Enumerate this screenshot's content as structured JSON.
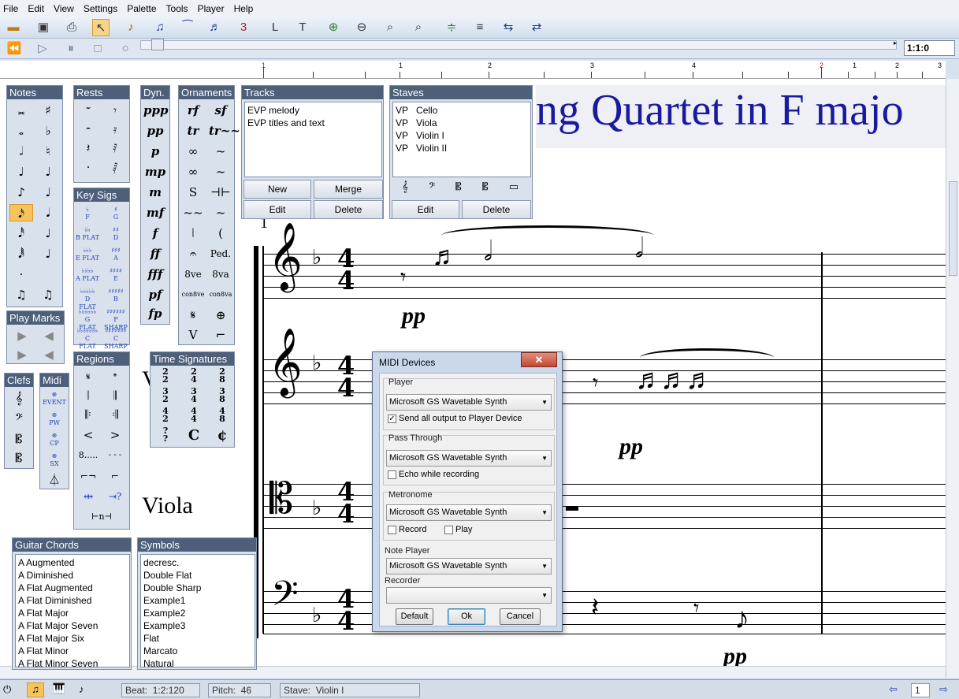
{
  "menu": [
    "File",
    "Edit",
    "View",
    "Settings",
    "Palette",
    "Tools",
    "Player",
    "Help"
  ],
  "toolbar_icons": [
    "open-icon",
    "save-icon",
    "print-icon",
    "select-arrow-icon",
    "eighth-note-icon",
    "beamed-notes-icon",
    "tie-icon",
    "slur-icon",
    "triplet-icon",
    "L-tool-icon",
    "T-tool-icon",
    "zoom-in-icon",
    "zoom-out-icon",
    "zoom-fit-icon",
    "zoom-region-icon",
    "add-staff-icon",
    "remove-staff-icon",
    "move-staff-up-icon",
    "move-staff-down-icon"
  ],
  "transport": {
    "position": "1:1:0"
  },
  "ruler": {
    "marks": [
      "1",
      "1",
      "2",
      "3",
      "4",
      "2",
      "1",
      "2",
      "3"
    ]
  },
  "score": {
    "title": "ng Quartet in F majo",
    "measure_number": "1",
    "names": [
      "Vi",
      "Viola"
    ],
    "dynamics": [
      "pp",
      "pp",
      "pp"
    ],
    "time_sig_top": "4",
    "time_sig_bottom": "4"
  },
  "palettes": {
    "notes": {
      "title": "Notes"
    },
    "rests": {
      "title": "Rests"
    },
    "dyn": {
      "title": "Dyn.",
      "items": [
        "ppp",
        "pp",
        "p",
        "mp",
        "m",
        "mf",
        "f",
        "ff",
        "fff",
        "pf",
        "fp"
      ]
    },
    "ornaments": {
      "title": "Ornaments",
      "items": [
        "rf",
        "sf",
        "tr",
        "tr~~",
        "∞",
        "~",
        "∞",
        "~",
        "S",
        "⊣⊢",
        "~~",
        "~",
        "⦚",
        "(",
        "𝄐",
        "Ped.",
        "8ve",
        "8va",
        "con8ve",
        "con8va",
        "𝄋",
        "⊕",
        "V",
        "⌐"
      ]
    },
    "keysigs": {
      "title": "Key Sigs",
      "items": [
        "F",
        "G",
        "B FLAT",
        "D",
        "E FLAT",
        "A",
        "A FLAT",
        "E",
        "D FLAT",
        "B",
        "G FLAT",
        "F SHARP",
        "C FLAT",
        "C SHARP"
      ]
    },
    "playmarks": {
      "title": "Play Marks"
    },
    "clefs": {
      "title": "Clefs"
    },
    "midi": {
      "title": "Midi",
      "items": [
        "EVENT",
        "PW",
        "CP",
        "SX"
      ]
    },
    "regions": {
      "title": "Regions",
      "items": [
        "8....."
      ]
    },
    "timesigs": {
      "title": "Time Signatures",
      "items": [
        [
          "2",
          "2"
        ],
        [
          "2",
          "4"
        ],
        [
          "2",
          "8"
        ],
        [
          "3",
          "2"
        ],
        [
          "3",
          "4"
        ],
        [
          "3",
          "8"
        ],
        [
          "4",
          "2"
        ],
        [
          "4",
          "4"
        ],
        [
          "4",
          "8"
        ],
        [
          "?",
          "?"
        ],
        [
          "C",
          ""
        ],
        [
          "¢",
          ""
        ]
      ]
    },
    "guitar": {
      "title": "Guitar Chords",
      "items": [
        "A Augmented",
        "A Diminished",
        "A Flat Augmented",
        "A Flat Diminished",
        "A Flat Major",
        "A Flat Major Seven",
        "A Flat Major Six",
        "A Flat Minor",
        "A Flat Minor Seven"
      ]
    },
    "symbols": {
      "title": "Symbols",
      "items": [
        "decresc.",
        "Double Flat",
        "Double Sharp",
        "Example1",
        "Example2",
        "Example3",
        "Flat",
        "Marcato",
        "Natural"
      ]
    }
  },
  "tracks": {
    "title": "Tracks",
    "items": [
      "EVP  melody",
      "EVP  titles and text"
    ],
    "buttons": {
      "new": "New",
      "merge": "Merge",
      "edit": "Edit",
      "delete": "Delete"
    }
  },
  "staves": {
    "title": "Staves",
    "items": [
      [
        "VP",
        "Cello"
      ],
      [
        "VP",
        "Viola"
      ],
      [
        "VP",
        "Violin I"
      ],
      [
        "VP",
        "Violin II"
      ]
    ],
    "buttons": {
      "edit": "Edit",
      "delete": "Delete"
    }
  },
  "dialog": {
    "title": "MIDI Devices",
    "player_label": "Player",
    "player_value": "Microsoft GS Wavetable Synth",
    "send_all": "Send all output to Player Device",
    "pass_label": "Pass Through",
    "pass_value": "Microsoft GS Wavetable Synth",
    "echo": "Echo while recording",
    "metronome_label": "Metronome",
    "metronome_value": "Microsoft GS Wavetable Synth",
    "record": "Record",
    "play": "Play",
    "note_player_label": "Note Player",
    "note_player_value": "Microsoft GS Wavetable Synth",
    "recorder_label": "Recorder",
    "recorder_value": "",
    "default_btn": "Default",
    "ok_btn": "Ok",
    "cancel_btn": "Cancel"
  },
  "status": {
    "beat_label": "Beat:",
    "beat": "1:2:120",
    "pitch_label": "Pitch:",
    "pitch": "46",
    "stave_label": "Stave:",
    "stave": "Violin I",
    "page": "1"
  }
}
